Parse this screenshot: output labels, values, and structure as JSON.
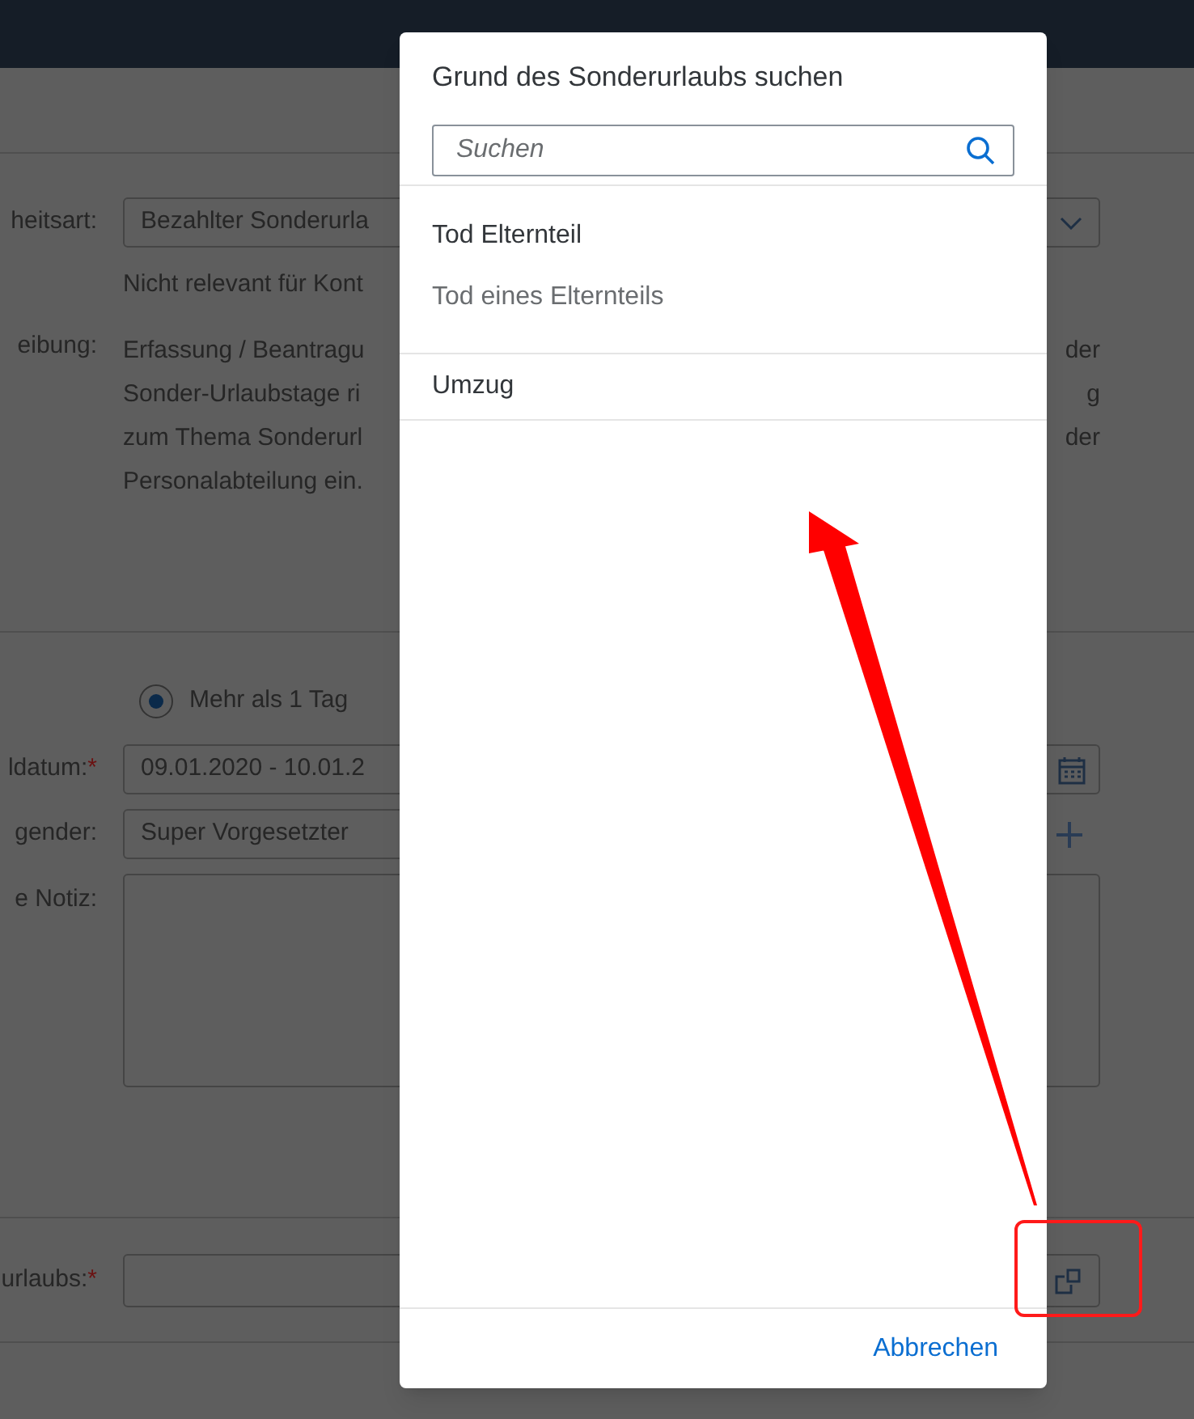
{
  "form": {
    "type_field": {
      "label": "heitsart:",
      "value": "Bezahlter Sonderurla"
    },
    "type_hint": "Nicht relevant für Kont",
    "description": {
      "label": "eibung:",
      "lines": [
        {
          "left": "Erfassung / Beantragu",
          "right": "der"
        },
        {
          "left": "Sonder-Urlaubstage ri",
          "right": "g"
        },
        {
          "left": "zum Thema Sonderurl",
          "right": "der"
        },
        {
          "left": "Personalabteilung ein."
        }
      ]
    },
    "duration_options": [
      {
        "label": "Mehr als 1 Tag",
        "selected": true
      }
    ],
    "date_field": {
      "label": "ldatum:",
      "required_mark": "*",
      "value": "09.01.2020 - 10.01.2"
    },
    "approver_field": {
      "label": "gender:",
      "value": "Super Vorgesetzter"
    },
    "note_field": {
      "label": "e Notiz:"
    },
    "reason_field": {
      "label": "urlaubs:",
      "required_mark": "*"
    }
  },
  "dialog": {
    "title": "Grund des Sonderurlaubs suchen",
    "search": {
      "placeholder": "Suchen"
    },
    "items": [
      {
        "title": "Tod Elternteil",
        "description": "Tod eines Elternteils"
      },
      {
        "title": "Umzug"
      }
    ],
    "buttons": [
      "Abbrechen"
    ]
  }
}
